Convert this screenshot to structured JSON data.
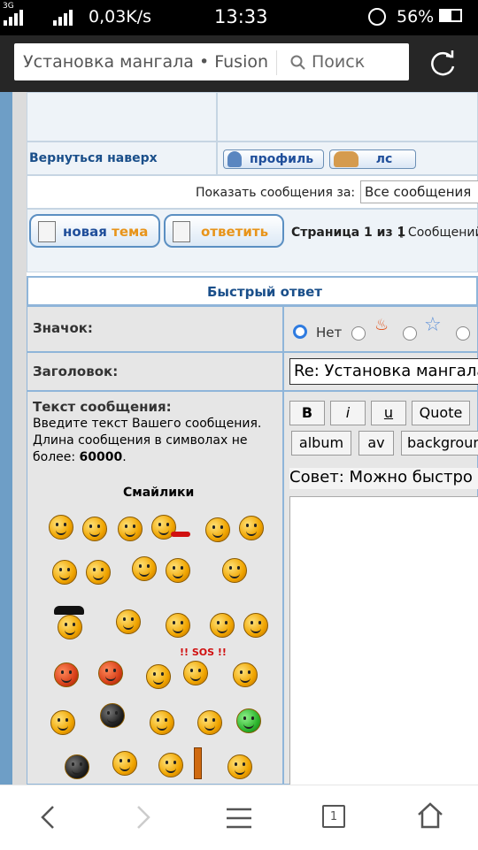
{
  "status": {
    "net_label": "3G",
    "speed": "0,03K/s",
    "time": "13:33",
    "battery": "56%"
  },
  "browser": {
    "page_title": "Установка мангала • Fusion",
    "search_label": "Поиск"
  },
  "forum": {
    "back_to_top": "Вернуться наверх",
    "profile_button": "профиль",
    "pm_button": "лс",
    "show_messages_label": "Показать сообщения за:",
    "show_messages_value": "Все сообщения",
    "new_topic_button": "новая тема",
    "new_topic_prefix": "новая ",
    "new_topic_word": "тема",
    "reply_button": "ответить",
    "page_info": "Страница 1 из 1",
    "messages_info": "[ Сообщений"
  },
  "quick_reply": {
    "title": "Быстрый ответ",
    "icon_label": "Значок:",
    "icon_none": "Нет",
    "subject_label": "Заголовок:",
    "subject_value": "Re: Установка мангала",
    "text_label": "Текст сообщения:",
    "text_hint_1": "Введите текст Вашего сообщения.",
    "text_hint_2": "Длина сообщения в символах не",
    "text_hint_3": "более: ",
    "text_hint_max": "60000",
    "text_hint_end": ".",
    "smilies_title": "Смайлики",
    "editor_buttons": {
      "bold": "B",
      "italic": "i",
      "underline": "u",
      "quote": "Quote",
      "album": "album",
      "av": "av",
      "background": "backgroun"
    },
    "tip": "Совет: Можно быстро п",
    "sos_text": "!! SOS !!"
  },
  "navbar": {
    "tab_count": "1"
  }
}
